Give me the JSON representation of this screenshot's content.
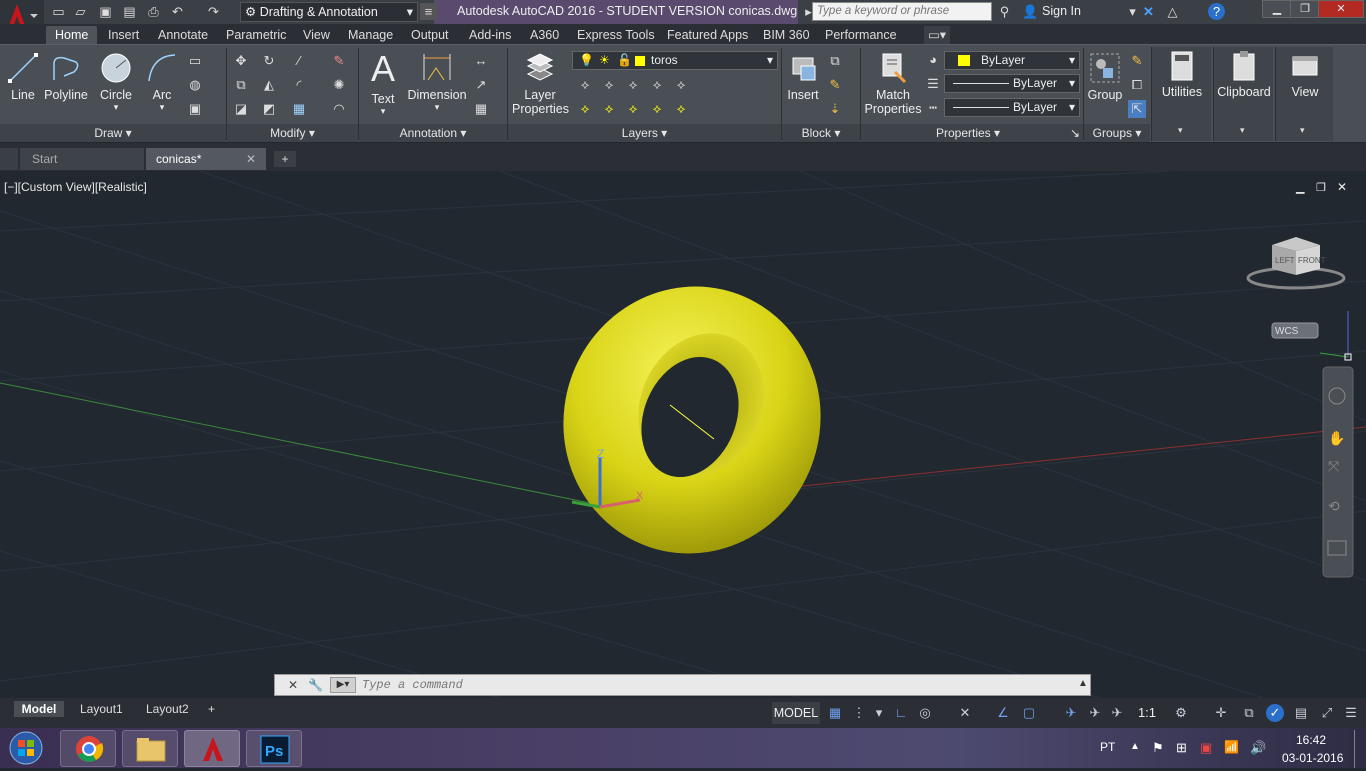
{
  "title_bar": {
    "workspace": "Drafting & Annotation",
    "app_title": "Autodesk AutoCAD 2016 - STUDENT VERSION    conicas.dwg",
    "search_placeholder": "Type a keyword or phrase",
    "sign_in": "Sign In"
  },
  "ribbon_tabs": [
    "Home",
    "Insert",
    "Annotate",
    "Parametric",
    "View",
    "Manage",
    "Output",
    "Add-ins",
    "A360",
    "Express Tools",
    "Featured Apps",
    "BIM 360",
    "Performance"
  ],
  "draw_panel": {
    "line": "Line",
    "polyline": "Polyline",
    "circle": "Circle",
    "arc": "Arc",
    "label": "Draw"
  },
  "modify_panel": {
    "label": "Modify"
  },
  "annotation_panel": {
    "text": "Text",
    "dimension": "Dimension",
    "label": "Annotation"
  },
  "layers_panel": {
    "layer_properties": "Layer\nProperties",
    "layer_properties_1": "Layer",
    "layer_properties_2": "Properties",
    "current_layer": "toros",
    "label": "Layers"
  },
  "block_panel": {
    "insert": "Insert",
    "label": "Block"
  },
  "properties_panel": {
    "match_1": "Match",
    "match_2": "Properties",
    "color": "ByLayer",
    "linetype": "ByLayer",
    "lineweight": "ByLayer",
    "label": "Properties"
  },
  "groups_panel": {
    "group": "Group",
    "label": "Groups"
  },
  "utilities": "Utilities",
  "clipboard": "Clipboard",
  "view": "View",
  "file_tabs": {
    "start": "Start",
    "active": "conicas*"
  },
  "viewport": {
    "label": "[−][Custom View][Realistic]",
    "wcs": "WCS",
    "viewcube_left": "LEFT",
    "viewcube_front": "FRONT"
  },
  "command": {
    "placeholder": "Type a command"
  },
  "layout_tabs": [
    "Model",
    "Layout1",
    "Layout2"
  ],
  "status": {
    "model": "MODEL",
    "scale": "1:1"
  },
  "taskbar": {
    "lang": "PT",
    "time": "16:42",
    "date": "03-01-2016"
  },
  "colors": {
    "torus": "#e6e31a",
    "ribbon_bg": "#4a4f56",
    "viewport_bg": "#212830",
    "accent": "#c8151b"
  }
}
